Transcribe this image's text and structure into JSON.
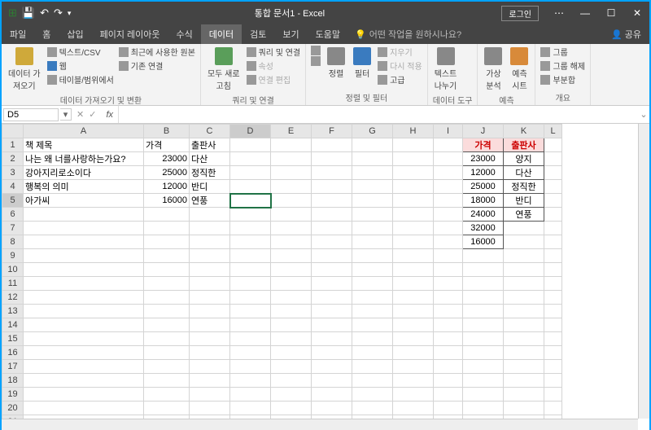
{
  "window": {
    "title": "통합 문서1 - Excel",
    "login": "로그인",
    "qat": {
      "save": "save",
      "undo": "undo",
      "redo": "redo"
    }
  },
  "tabs": {
    "items": [
      "파일",
      "홈",
      "삽입",
      "페이지 레이아웃",
      "수식",
      "데이터",
      "검토",
      "보기",
      "도움말"
    ],
    "active_index": 5,
    "tellme_placeholder": "어떤 작업을 원하시나요?",
    "share": "공유"
  },
  "ribbon": {
    "g0": {
      "big": "데이터 가\n져오기",
      "b0": "텍스트/CSV",
      "b1": "웹",
      "b2": "테이블/범위에서",
      "b3": "최근에 사용한 원본",
      "b4": "기존 연결",
      "label": "데이터 가져오기 및 변환"
    },
    "g1": {
      "big": "모두 새로\n고침",
      "b0": "쿼리 및 연결",
      "b1": "속성",
      "b2": "연결 편집",
      "label": "쿼리 및 연결"
    },
    "g2": {
      "sort": "정렬",
      "filter": "필터",
      "b0": "지우기",
      "b1": "다시 적용",
      "b2": "고급",
      "label": "정렬 및 필터"
    },
    "g3": {
      "big": "텍스트\n나누기",
      "label": "데이터 도구"
    },
    "g4": {
      "b0": "가상\n분석",
      "b1": "예측\n시트",
      "label": "예측"
    },
    "g5": {
      "b0": "그룹",
      "b1": "그룹 해제",
      "b2": "부분합",
      "label": "개요"
    }
  },
  "namebox": {
    "cell": "D5",
    "fx": "fx"
  },
  "columns": [
    "",
    "A",
    "B",
    "C",
    "D",
    "E",
    "F",
    "G",
    "H",
    "I",
    "J",
    "K",
    "L"
  ],
  "rows_visible": 21,
  "chart_data": {
    "type": "table",
    "main": {
      "headers": [
        "책 제목",
        "가격",
        "출판사"
      ],
      "rows": [
        [
          "나는 왜 너를사랑하는가요?",
          23000,
          "다산"
        ],
        [
          "강아지리로소이다",
          25000,
          "정직한"
        ],
        [
          "행복의 의미",
          12000,
          "반디"
        ],
        [
          "아가씨",
          16000,
          "연풍"
        ]
      ]
    },
    "lookup": {
      "headers": [
        "가격",
        "출판사"
      ],
      "rows": [
        [
          23000,
          "양지"
        ],
        [
          12000,
          "다산"
        ],
        [
          25000,
          "정직한"
        ],
        [
          18000,
          "반디"
        ],
        [
          24000,
          "연풍"
        ],
        [
          32000,
          ""
        ],
        [
          16000,
          ""
        ]
      ]
    }
  }
}
